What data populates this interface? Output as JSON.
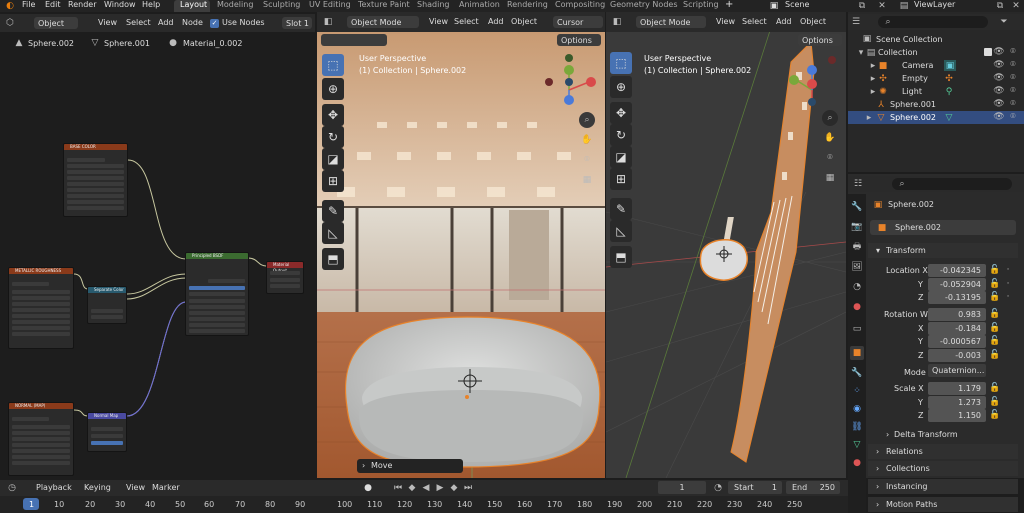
{
  "topbar": {
    "menus": [
      "File",
      "Edit",
      "Render",
      "Window",
      "Help"
    ],
    "workspaces": [
      "Layout",
      "Modeling",
      "Sculpting",
      "UV Editing",
      "Texture Paint",
      "Shading",
      "Animation",
      "Rendering",
      "Compositing",
      "Geometry Nodes",
      "Scripting"
    ],
    "add_tab": "+",
    "scene": "Scene",
    "view_layer": "ViewLayer"
  },
  "node_editor": {
    "mode": "Object",
    "menus": [
      "View",
      "Select",
      "Add",
      "Node"
    ],
    "use_nodes": "Use Nodes",
    "slot": "Slot 1",
    "breadcrumb": [
      "Sphere.002",
      "Sphere.001",
      "Material_0.002"
    ],
    "nodes": {
      "base_color": "BASE COLOR",
      "metallic_roughness": "METALLIC ROUGHNESS",
      "normal": "NORMAL (MAP)",
      "separate": "Separate Color",
      "normal_map": "Normal Map",
      "bsdf": "Principled BSDF",
      "output": "Material Output"
    }
  },
  "viewport_left": {
    "mode": "Object Mode",
    "menus": [
      "View",
      "Select",
      "Add",
      "Object"
    ],
    "pivot": "Cursor",
    "options": "Options",
    "perspective": "User Perspective",
    "collection": "(1) Collection | Sphere.002",
    "operator": "Move"
  },
  "viewport_right": {
    "mode": "Object Mode",
    "menus": [
      "View",
      "Select",
      "Add",
      "Object"
    ],
    "options": "Options",
    "perspective": "User Perspective",
    "collection": "(1) Collection | Sphere.002"
  },
  "outliner": {
    "scene_collection": "Scene Collection",
    "items": [
      "Collection",
      "Camera",
      "Empty",
      "Light",
      "Sphere.001",
      "Sphere.002"
    ]
  },
  "properties": {
    "object_name": "Sphere.002",
    "object_field": "Sphere.002",
    "transform": "Transform",
    "location_label": "Location X",
    "loc_x": "-0.042345",
    "loc_y": "-0.052904",
    "loc_z": "-0.13195",
    "rotation_label": "Rotation W",
    "rot_w": "0.983",
    "rot_x": "-0.184",
    "rot_y": "-0.000567",
    "rot_z": "-0.003",
    "mode_label": "Mode",
    "mode_value": "Quaternion...",
    "scale_label": "Scale X",
    "scale_x": "1.179",
    "scale_y": "1.273",
    "scale_z": "1.150",
    "axis_x": "X",
    "axis_y": "Y",
    "axis_z": "Z",
    "delta": "Delta Transform",
    "relations": "Relations",
    "collections": "Collections",
    "instancing": "Instancing",
    "motion_paths": "Motion Paths"
  },
  "timeline": {
    "playback": "Playback",
    "keying": "Keying",
    "view": "View",
    "marker": "Marker",
    "current_frame": "1",
    "start_label": "Start",
    "start": "1",
    "end_label": "End",
    "end": "250",
    "ruler": [
      "1",
      "10",
      "20",
      "30",
      "40",
      "50",
      "60",
      "70",
      "80",
      "90",
      "100",
      "110",
      "120",
      "130",
      "140",
      "150",
      "160",
      "170",
      "180",
      "190",
      "200",
      "210",
      "220",
      "230",
      "240",
      "250"
    ]
  },
  "colors": {
    "accent": "#4772b3",
    "node_color_header": "#8a3a1a",
    "bsdf_header": "#3b6b30",
    "selection_orange": "#e8832a"
  }
}
